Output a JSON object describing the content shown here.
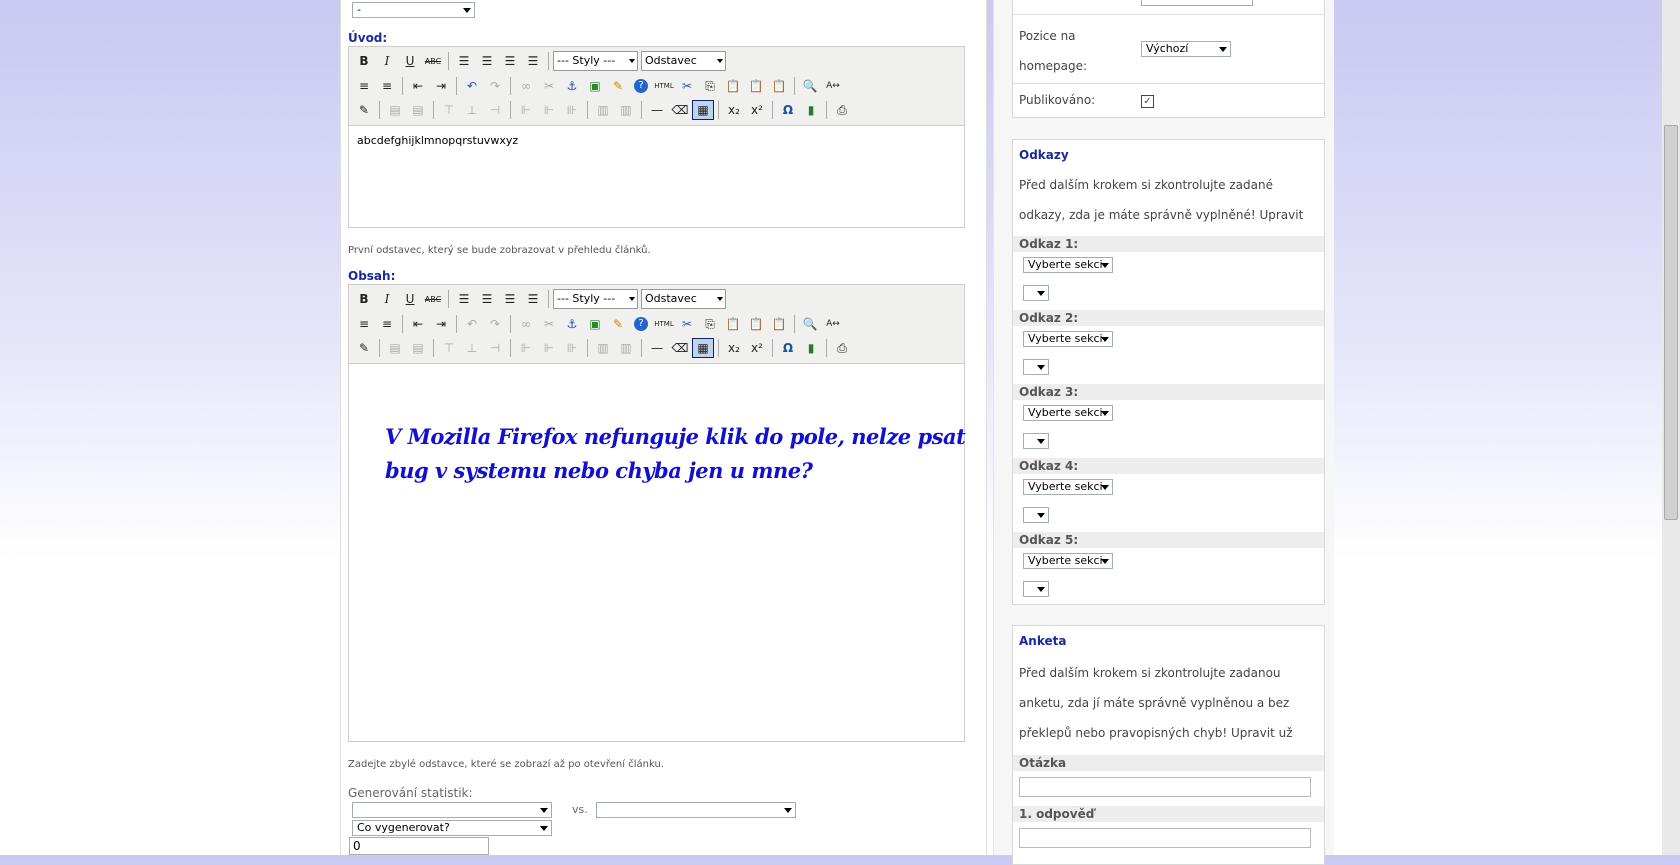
{
  "top_select": {
    "value": "-"
  },
  "uvod": {
    "label": "Úvod:",
    "hint": "První odstavec, který se bude zobrazovat v přehledu článků.",
    "content": "abcdefghijklmnopqrstuvwxyz"
  },
  "obsah": {
    "label": "Obsah:",
    "hint": "Zadejte zbylé odstavce, které se zobrazí až po otevření článku.",
    "content_line1": "V Mozilla Firefox nefunguje klik do pole, nelze psat",
    "content_line2": "bug v systemu nebo chyba jen u mne?",
    "content_color": "#1010d0"
  },
  "toolbar": {
    "styles_label": "--- Styly ---",
    "format_label": "Odstavec",
    "bold": "B",
    "italic": "I",
    "underline": "U",
    "strike": "ABC",
    "html": "HTML",
    "omega": "Ω",
    "sub": "x₂",
    "sup": "x²"
  },
  "stats": {
    "label": "Generování statistik:",
    "vs": "vs.",
    "select1": "",
    "select2": "",
    "select3": "Co vygenerovat?",
    "input_value": "0"
  },
  "sidebar": {
    "pozice_label": "Pozice na homepage:",
    "pozice_value": "Výchozí",
    "publikovano_label": "Publikováno:",
    "odkazy": {
      "title": "Odkazy",
      "text": "Před dalším krokem si zkontrolujte zadané odkazy, zda je máte správně vyplněné! Upravit už totiž nejdou!",
      "items": [
        {
          "label": "Odkaz 1:",
          "select": "Vyberte sekci"
        },
        {
          "label": "Odkaz 2:",
          "select": "Vyberte sekci"
        },
        {
          "label": "Odkaz 3:",
          "select": "Vyberte sekci"
        },
        {
          "label": "Odkaz 4:",
          "select": "Vyberte sekci"
        },
        {
          "label": "Odkaz 5:",
          "select": "Vyberte sekci"
        }
      ]
    },
    "anketa": {
      "title": "Anketa",
      "text": "Před dalším krokem si zkontrolujte zadanou anketu, zda jí máte správně vyplněnou a bez překlepů nebo pravopisných chyb! Upravit už totiž nejde!",
      "otazka_label": "Otázka",
      "odpoved_label": "1. odpověď"
    }
  }
}
